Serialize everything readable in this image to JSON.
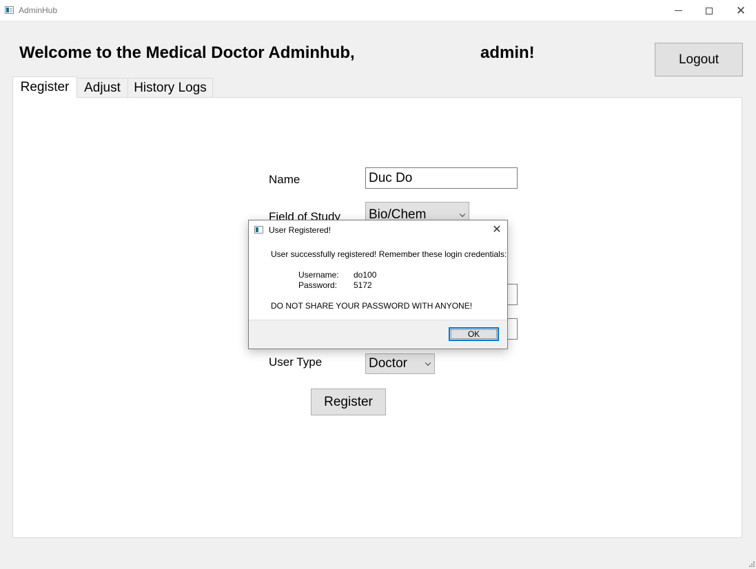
{
  "window": {
    "title": "AdminHub",
    "minimize_icon": "minimize-icon",
    "maximize_icon": "maximize-icon",
    "close_icon": "close-icon",
    "close_glyph": "✕"
  },
  "header": {
    "welcome_text": "Welcome to the Medical Doctor Adminhub,",
    "username_text": "admin!",
    "logout_label": "Logout"
  },
  "tabs": [
    {
      "label": "Register",
      "active": true
    },
    {
      "label": "Adjust",
      "active": false
    },
    {
      "label": "History Logs",
      "active": false
    }
  ],
  "form": {
    "name_label": "Name",
    "name_value": "Duc Do",
    "field_label": "Field of Study",
    "field_value": "Bio/Chem",
    "user_type_label": "User Type",
    "user_type_value": "Doctor",
    "register_label": "Register"
  },
  "dialog": {
    "title": "User Registered!",
    "close_glyph": "✕",
    "message": "User successfully registered! Remember these login credentials:",
    "username_label": "Username:",
    "username_value": "do100",
    "password_label": "Password:",
    "password_value": "5172",
    "warning": "DO NOT SHARE YOUR PASSWORD WITH ANYONE!",
    "ok_label": "OK"
  },
  "colors": {
    "window_bg": "#f0f0f0",
    "focus_accent": "#0078d7"
  }
}
